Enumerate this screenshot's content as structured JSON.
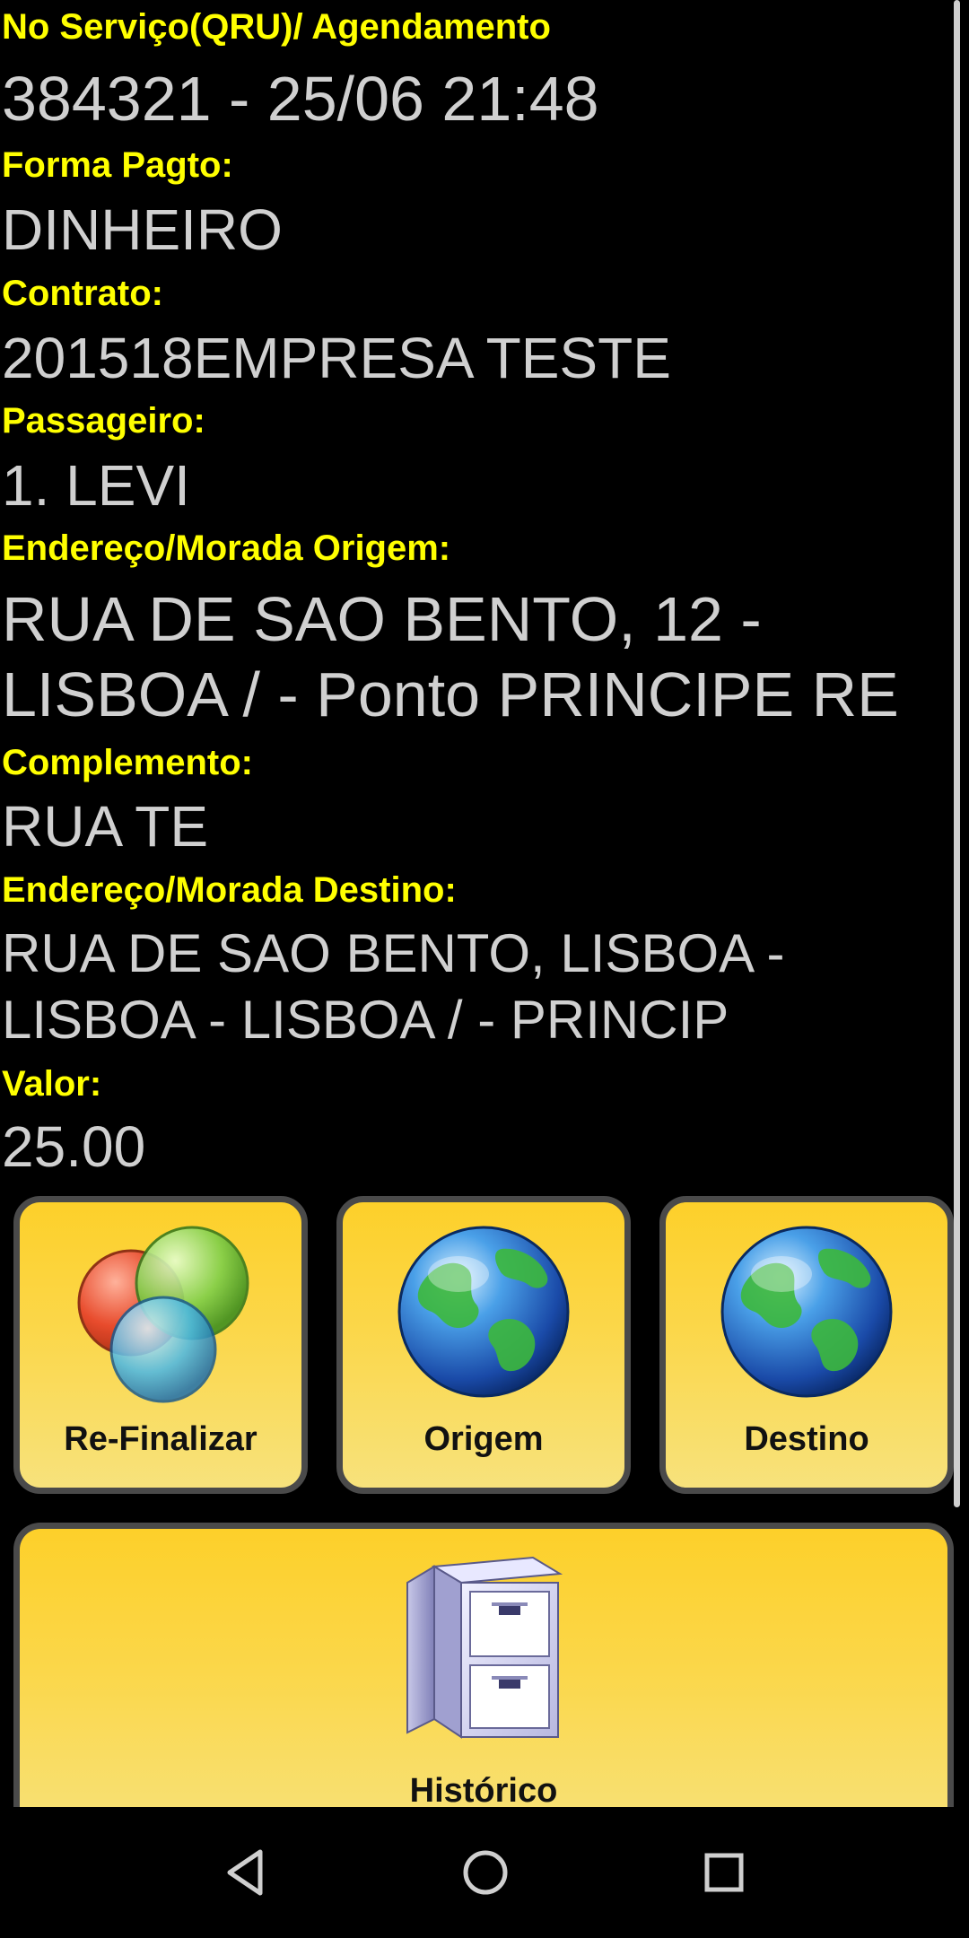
{
  "service": {
    "label": "No Serviço(QRU)/ Agendamento",
    "value": "384321 - 25/06 21:48"
  },
  "payment": {
    "label": "Forma Pagto:",
    "value": "DINHEIRO"
  },
  "contract": {
    "label": "Contrato:",
    "value": "201518EMPRESA TESTE"
  },
  "passenger": {
    "label": "Passageiro:",
    "value": "1. LEVI"
  },
  "origin": {
    "label": "Endereço/Morada Origem:",
    "value": "RUA DE SAO BENTO, 12 - LISBOA / - Ponto PRINCIPE RE"
  },
  "complement": {
    "label": "Complemento:",
    "value": "RUA TE"
  },
  "destination": {
    "label": "Endereço/Morada Destino:",
    "value": "RUA DE SAO BENTO, LISBOA - LISBOA - LISBOA / - PRINCIP"
  },
  "amount": {
    "label": "Valor:",
    "value": "25.00"
  },
  "buttons": {
    "refinalizar": "Re-Finalizar",
    "origem": "Origem",
    "destino": "Destino",
    "historico": "Histórico"
  },
  "colors": {
    "label": "#ffff00",
    "value": "#d0d0d0",
    "button_top": "#fdd02a",
    "button_bottom": "#f7e27c",
    "button_border": "#4a4a4a",
    "background": "#000000"
  },
  "icons": {
    "refinalizar": "venn-circles-icon",
    "origem": "globe-icon",
    "destino": "globe-icon",
    "historico": "file-cabinet-icon",
    "nav_back": "back-triangle-icon",
    "nav_home": "home-circle-icon",
    "nav_recent": "recent-apps-square-icon"
  }
}
